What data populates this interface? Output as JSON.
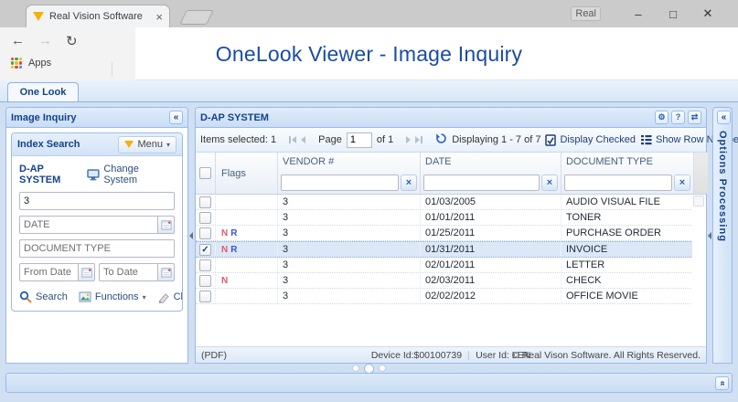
{
  "browser": {
    "tab_title": "Real Vision Software",
    "profile_badge": "Real",
    "apps_label": "Apps",
    "page_title": "OneLook Viewer - Image Inquiry"
  },
  "icons": {
    "back": "←",
    "forward": "→",
    "reload": "↻",
    "tab_close": "×",
    "minimize": "–",
    "maximize": "□",
    "close": "✕",
    "collapse_left": "«",
    "expand_up": "«",
    "gear": "⚙",
    "help": "?",
    "sync": "⇄",
    "clear_x": "×",
    "check": "✓",
    "menu_caret": "▾"
  },
  "app_tab": {
    "label": "One Look"
  },
  "sidebar": {
    "panel_title": "Image Inquiry",
    "index_search": {
      "title": "Index Search",
      "menu_label": "Menu",
      "system_label": "D-AP SYSTEM",
      "change_system_label": "Change System",
      "vendor_value": "3",
      "date_placeholder": "DATE",
      "doctype_placeholder": "DOCUMENT TYPE",
      "from_date_placeholder": "From Date",
      "to_date_placeholder": "To Date",
      "search_label": "Search",
      "functions_label": "Functions",
      "clear_label": "Clear"
    }
  },
  "grid": {
    "panel_title": "D-AP SYSTEM",
    "toolbar": {
      "items_selected": "Items selected: 1",
      "page_label": "Page",
      "page_value": "1",
      "of_label": "of 1",
      "displaying": "Displaying 1 - 7 of 7",
      "display_checked_label": "Display Checked",
      "show_row_number_label": "Show Row Number"
    },
    "columns": [
      "Flags",
      "VENDOR #",
      "DATE",
      "DOCUMENT TYPE"
    ],
    "rows": [
      {
        "checked": false,
        "flags": [],
        "vendor": "3",
        "date": "01/03/2005",
        "doc_type": "AUDIO VISUAL FILE",
        "selected": false
      },
      {
        "checked": false,
        "flags": [],
        "vendor": "3",
        "date": "01/01/2011",
        "doc_type": "TONER",
        "selected": false
      },
      {
        "checked": false,
        "flags": [
          "N",
          "R"
        ],
        "vendor": "3",
        "date": "01/25/2011",
        "doc_type": "PURCHASE ORDER",
        "selected": false
      },
      {
        "checked": true,
        "flags": [
          "N",
          "R"
        ],
        "vendor": "3",
        "date": "01/31/2011",
        "doc_type": "INVOICE",
        "selected": true
      },
      {
        "checked": false,
        "flags": [],
        "vendor": "3",
        "date": "02/01/2011",
        "doc_type": "LETTER",
        "selected": false
      },
      {
        "checked": false,
        "flags": [
          "N"
        ],
        "vendor": "3",
        "date": "02/03/2011",
        "doc_type": "CHECK",
        "selected": false
      },
      {
        "checked": false,
        "flags": [],
        "vendor": "3",
        "date": "02/02/2012",
        "doc_type": "OFFICE MOVIE",
        "selected": false
      }
    ],
    "footer": {
      "format": "(PDF)",
      "device_id": "Device Id:$00100739",
      "user_id": "User Id: LEN",
      "copyright": "© Real Vison Software. All Rights Reserved."
    }
  },
  "right_panel": {
    "title": "Options Processing"
  },
  "colors": {
    "accent": "#15428b",
    "title_blue": "#1a4ca6",
    "panel_border": "#99bbe8",
    "selected_row_bg": "#dce8f8",
    "flag_n": "#e8566a",
    "flag_r": "#3c57c4"
  }
}
